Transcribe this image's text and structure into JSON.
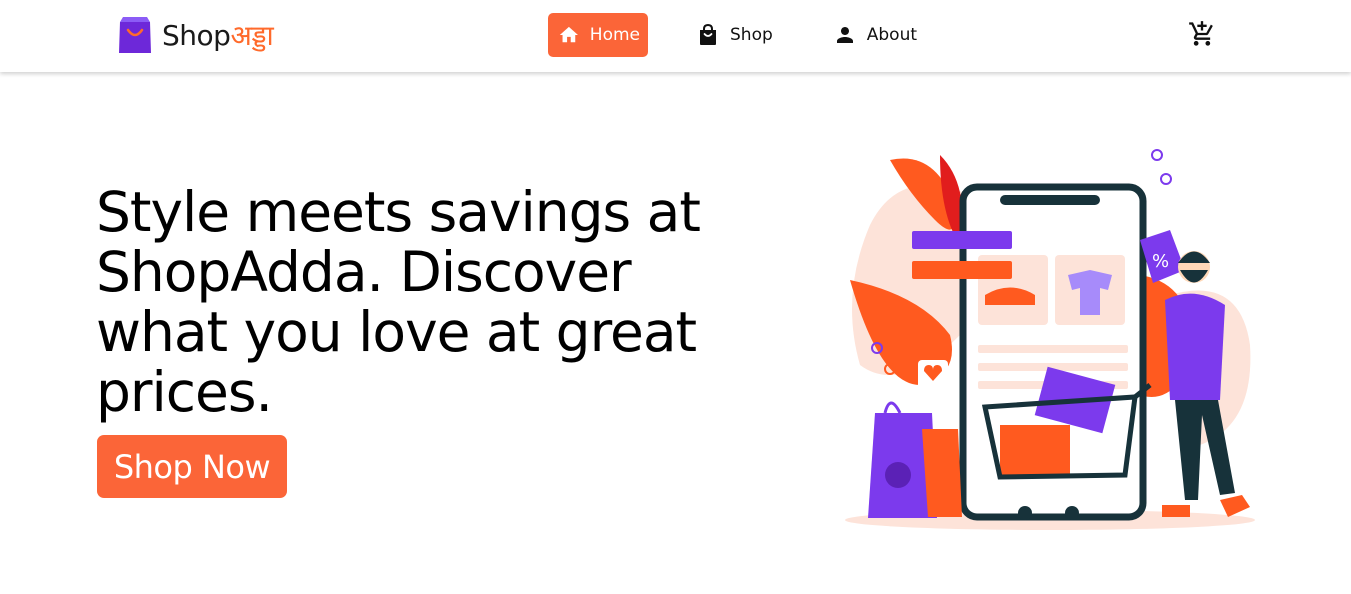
{
  "brand": {
    "name_part1": "Shop",
    "name_part2": "अड्डा"
  },
  "nav": {
    "items": [
      {
        "label": "Home",
        "icon": "home-icon",
        "active": true
      },
      {
        "label": "Shop",
        "icon": "shopping-bag-icon",
        "active": false
      },
      {
        "label": "About",
        "icon": "person-icon",
        "active": false
      }
    ],
    "cart_icon": "cart-icon"
  },
  "hero": {
    "headline": "Style meets savings at ShopAdda. Discover what you love at great prices.",
    "cta_label": "Shop Now"
  },
  "colors": {
    "accent": "#fb6538",
    "brand_bag": "#6d28d9",
    "illustration_purple": "#7c3aed",
    "illustration_orange": "#ff5a1f"
  }
}
